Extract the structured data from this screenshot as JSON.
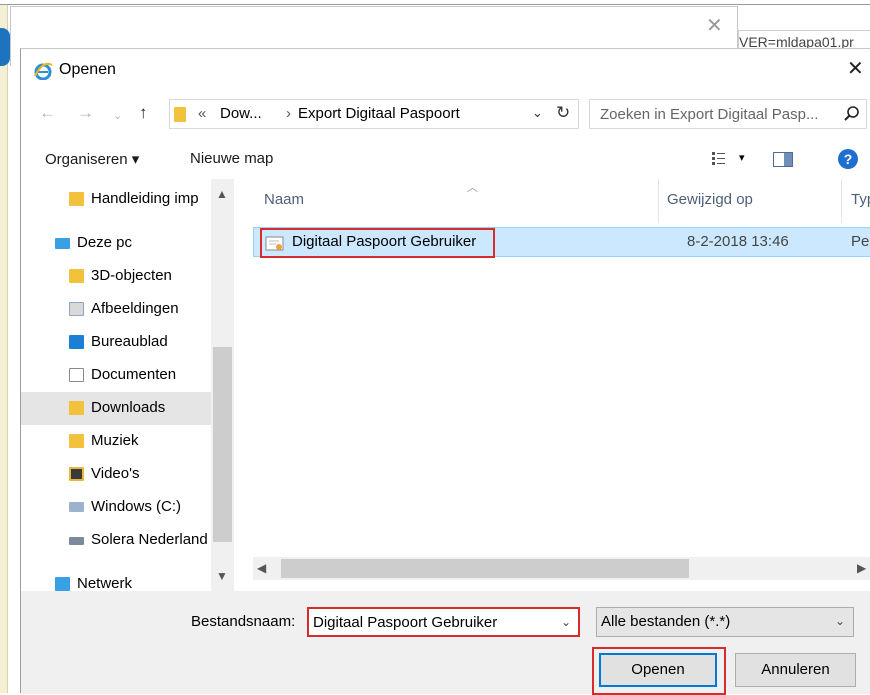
{
  "background": {
    "url_text": "VER=mldapa01.pr"
  },
  "dialog": {
    "title": "Openen",
    "close_icon": "close-icon"
  },
  "address_bar": {
    "overflow": "«",
    "crumbs": [
      "Dow...",
      "Export Digitaal Paspoort"
    ],
    "separator": "›",
    "search_placeholder": "Zoeken in Export Digitaal Pasp..."
  },
  "toolbar": {
    "organize_label": "Organiseren ▾",
    "new_folder_label": "Nieuwe map",
    "help_label": "?"
  },
  "nav_pane": {
    "items": [
      {
        "label": "Handleiding imp",
        "icon": "folder-icon"
      },
      {
        "label": "Deze pc",
        "icon": "computer-icon"
      },
      {
        "label": "3D-objecten",
        "icon": "3d-objects-icon"
      },
      {
        "label": "Afbeeldingen",
        "icon": "pictures-icon"
      },
      {
        "label": "Bureaublad",
        "icon": "desktop-icon"
      },
      {
        "label": "Documenten",
        "icon": "documents-icon"
      },
      {
        "label": "Downloads",
        "icon": "downloads-icon",
        "selected": true
      },
      {
        "label": "Muziek",
        "icon": "music-icon"
      },
      {
        "label": "Video's",
        "icon": "videos-icon"
      },
      {
        "label": "Windows (C:)",
        "icon": "drive-icon"
      },
      {
        "label": "Solera Nederland",
        "icon": "network-drive-icon"
      },
      {
        "label": "Netwerk",
        "icon": "network-icon"
      }
    ]
  },
  "file_list": {
    "columns": [
      "Naam",
      "Gewijzigd op",
      "Type"
    ],
    "rows": [
      {
        "name": "Digitaal Paspoort Gebruiker",
        "modified": "8-2-2018 13:46",
        "type": "Pe"
      }
    ]
  },
  "bottom": {
    "filename_label": "Bestandsnaam:",
    "filename_value": "Digitaal Paspoort Gebruiker",
    "filter_value": "Alle bestanden (*.*)",
    "open_label": "Openen",
    "cancel_label": "Annuleren"
  },
  "colors": {
    "highlight_red": "#d62c2c",
    "selection_blue": "#cce8ff",
    "accent_blue": "#0078d7"
  }
}
